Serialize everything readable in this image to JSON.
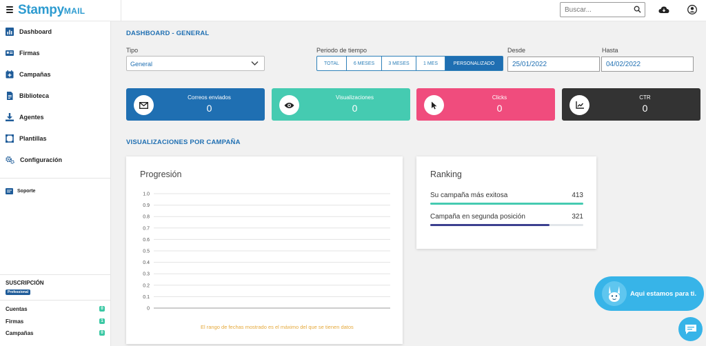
{
  "app": {
    "brand_main": "Stampy",
    "brand_sub": "MAIL"
  },
  "topbar": {
    "search_placeholder": "Buscar...",
    "icons": [
      "menu-icon",
      "search-icon",
      "cloud-icon",
      "user-icon"
    ]
  },
  "sidebar": {
    "items": [
      {
        "label": "Dashboard",
        "icon": "chart-icon"
      },
      {
        "label": "Firmas",
        "icon": "id-card-icon"
      },
      {
        "label": "Campañas",
        "icon": "calendar-plus-icon"
      },
      {
        "label": "Biblioteca",
        "icon": "file-icon"
      },
      {
        "label": "Agentes",
        "icon": "download-icon"
      },
      {
        "label": "Plantillas",
        "icon": "template-icon"
      },
      {
        "label": "Configuración",
        "icon": "cogs-icon"
      }
    ],
    "support_label": "Soporte",
    "subscription": {
      "title": "SUSCRIPCIÓN",
      "plan": "Professional",
      "quotas": [
        {
          "label": "Cuentas",
          "value": "0"
        },
        {
          "label": "Firmas",
          "value": "1"
        },
        {
          "label": "Campañas",
          "value": "0"
        }
      ]
    }
  },
  "main": {
    "title": "DASHBOARD - GENERAL",
    "filters": {
      "tipo_label": "Tipo",
      "tipo_value": "General",
      "periodo_label": "Periodo de tiempo",
      "periodos": [
        "TOTAL",
        "6 MESES",
        "3 MESES",
        "1 MES",
        "PERSONALIZADO"
      ],
      "active_periodo": "PERSONALIZADO",
      "desde_label": "Desde",
      "desde_value": "25/01/2022",
      "hasta_label": "Hasta",
      "hasta_value": "04/02/2022"
    },
    "cards": [
      {
        "title": "Correos enviados",
        "value": "0",
        "color": "#1f6fb2",
        "icon": "mail-icon"
      },
      {
        "title": "Visualizaciones",
        "value": "0",
        "color": "#45cbb1",
        "icon": "eye-icon"
      },
      {
        "title": "Clicks",
        "value": "0",
        "color": "#f04c7d",
        "icon": "cursor-icon"
      },
      {
        "title": "CTR",
        "value": "0",
        "color": "#333333",
        "icon": "trend-icon"
      }
    ],
    "section_title": "VISUALIZACIONES POR CAMPAÑA",
    "progresion": {
      "title": "Progresión",
      "note": "El rango de fechas mostrado es el máximo del que se tienen datos"
    },
    "ranking": {
      "title": "Ranking",
      "rows": [
        {
          "label": "Su campaña más exitosa",
          "value": "413",
          "fraction": 1.0,
          "color": "#45cbb1"
        },
        {
          "label": "Campaña en segunda posición",
          "value": "321",
          "fraction": 0.78,
          "color": "#3b3f8f"
        }
      ]
    },
    "help_text": "Aqui estamos para ti."
  },
  "chart_data": {
    "type": "line",
    "title": "Progresión",
    "xlabel": "",
    "ylabel": "",
    "ylim": [
      0,
      1.0
    ],
    "yticks": [
      "1.0",
      "0.9",
      "0.8",
      "0.7",
      "0.6",
      "0.5",
      "0.4",
      "0.3",
      "0.2",
      "0.1",
      "0"
    ],
    "series": [],
    "grid": true
  }
}
